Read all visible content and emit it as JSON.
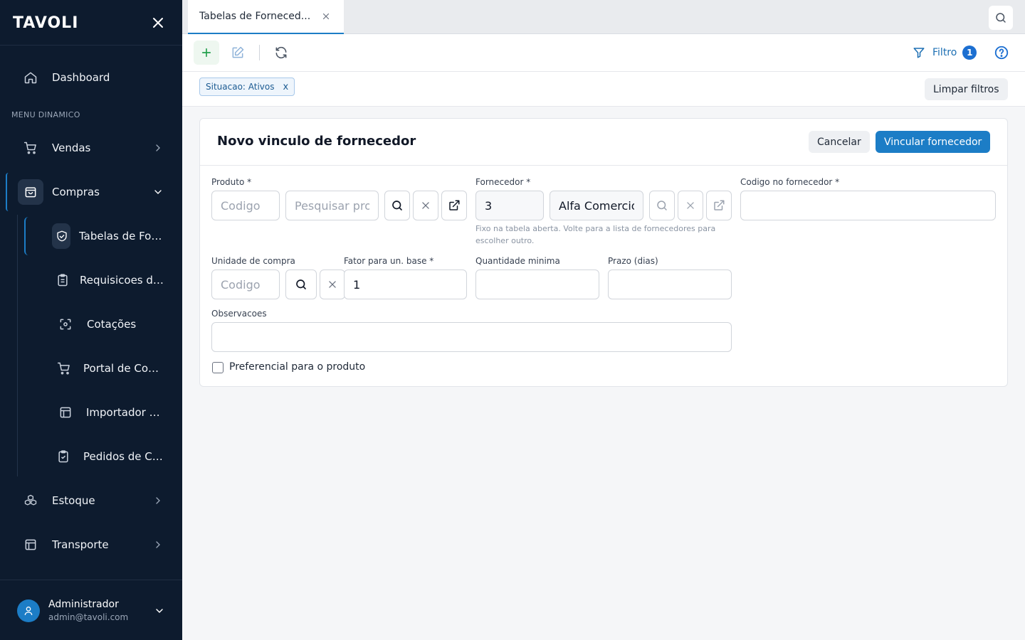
{
  "sidebar": {
    "brand": "TAVOLI",
    "section_label": "MENU DINAMICO",
    "items": [
      {
        "label": "Dashboard",
        "icon": "home-icon"
      },
      {
        "label": "Vendas",
        "icon": "cart-icon"
      },
      {
        "label": "Compras",
        "icon": "shopping-bag-icon"
      },
      {
        "label": "Estoque",
        "icon": "boxes-icon"
      },
      {
        "label": "Transporte",
        "icon": "layout-icon"
      }
    ],
    "sub_items": [
      {
        "label": "Tabelas de Fornecedores",
        "icon": "handshake-icon",
        "active": true
      },
      {
        "label": "Requisicoes de Compra",
        "icon": "clipboard-icon"
      },
      {
        "label": "Cotações",
        "icon": "scan-icon"
      },
      {
        "label": "Portal de Compras",
        "icon": "cart-icon"
      },
      {
        "label": "Importador XML",
        "icon": "table-icon"
      },
      {
        "label": "Pedidos de Compra",
        "icon": "clipboard-check-icon"
      }
    ],
    "user": {
      "name": "Administrador",
      "email": "admin@tavoli.com"
    }
  },
  "tabs": [
    {
      "label": "Tabelas de Forneced...",
      "active": true
    }
  ],
  "toolbar": {
    "filter_label": "Filtro",
    "filter_count": "1"
  },
  "filters": {
    "chip_label": "Situacao: Ativos",
    "chip_remove": "x",
    "clear_label": "Limpar filtros"
  },
  "form": {
    "title": "Novo vinculo de fornecedor",
    "cancel_label": "Cancelar",
    "submit_label": "Vincular fornecedor",
    "produto_label": "Produto *",
    "produto_codigo_placeholder": "Codigo",
    "produto_search_placeholder": "Pesquisar produto",
    "fornecedor_label": "Fornecedor *",
    "fornecedor_codigo": "3",
    "fornecedor_nome": "Alfa Comercio",
    "fornecedor_hint": "Fixo na tabela aberta. Volte para a lista de fornecedores para escolher outro.",
    "codigo_fornecedor_label": "Codigo no fornecedor *",
    "codigo_fornecedor_value": "",
    "unidade_label": "Unidade de compra",
    "unidade_placeholder": "Codigo",
    "fator_label": "Fator para un. base *",
    "fator_value": "1",
    "qtd_min_label": "Quantidade minima",
    "qtd_min_value": "",
    "prazo_label": "Prazo (dias)",
    "prazo_value": "",
    "obs_label": "Observacoes",
    "obs_value": "",
    "preferencial_label": "Preferencial para o produto",
    "preferencial_checked": false
  },
  "colors": {
    "sidebar_bg": "#0d1b2e",
    "accent": "#1c7dc6",
    "primary_button": "#1c7dc6",
    "add_icon": "#22a04b"
  }
}
